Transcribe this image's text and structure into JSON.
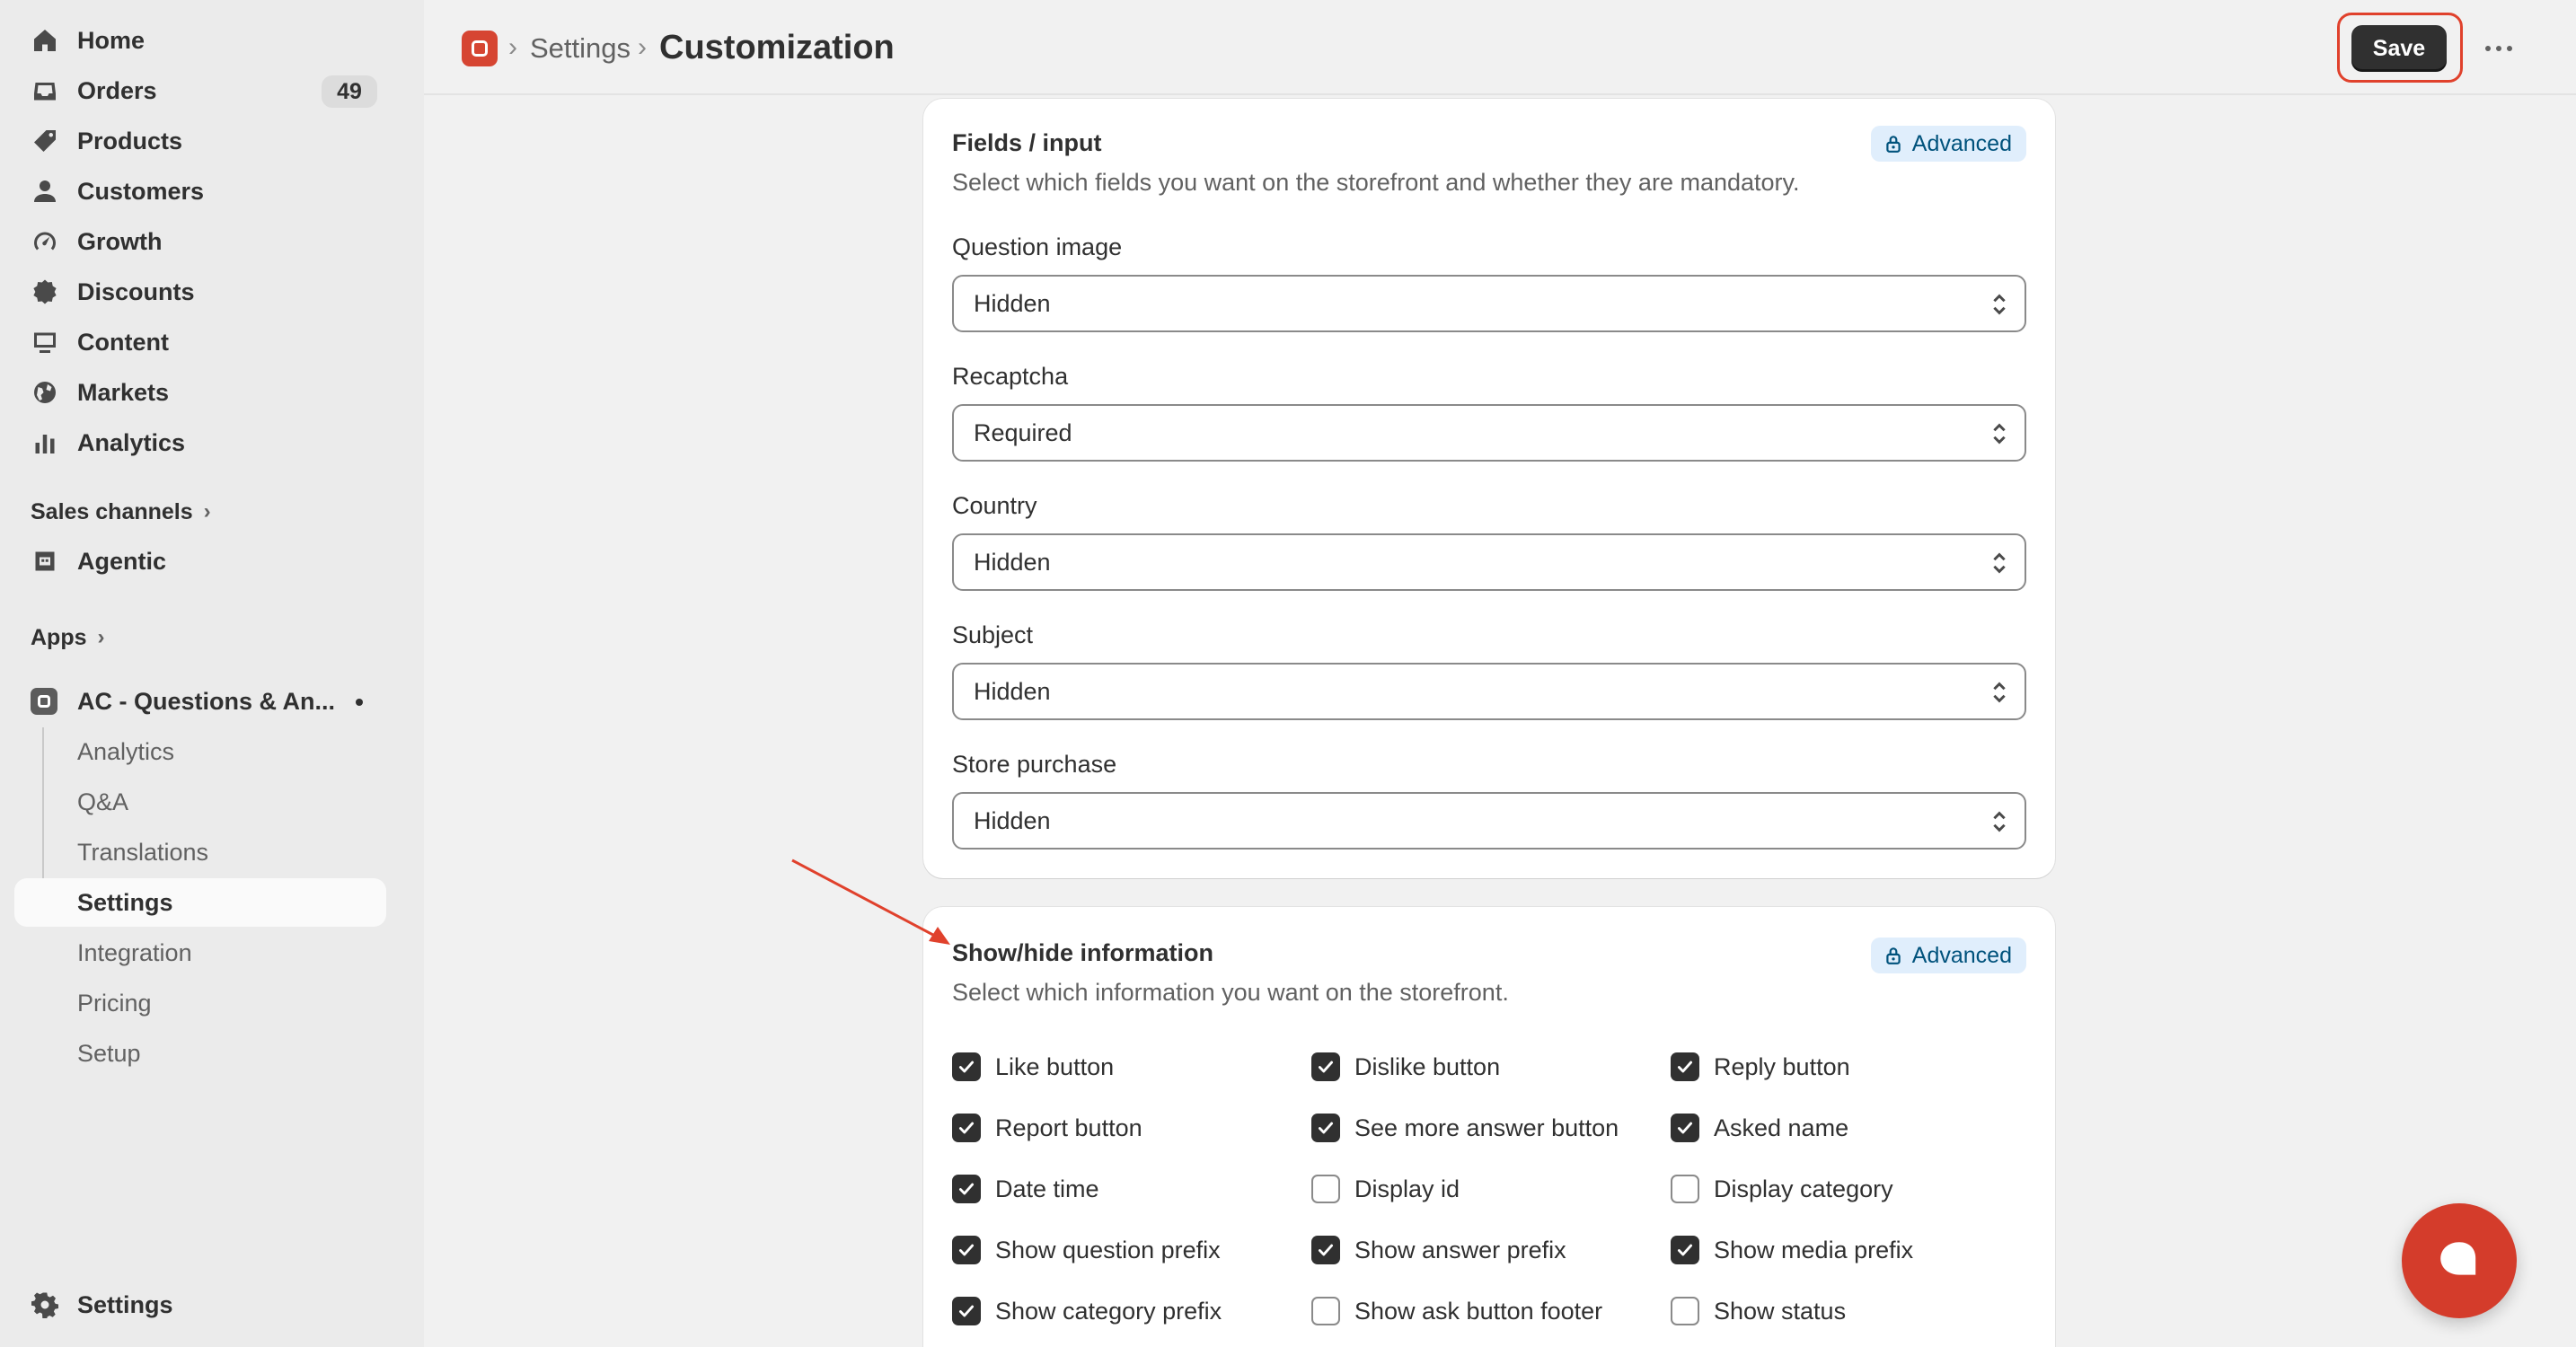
{
  "sidebar": {
    "items": [
      {
        "label": "Home",
        "icon": "home-icon"
      },
      {
        "label": "Orders",
        "icon": "orders-icon",
        "badge": "49"
      },
      {
        "label": "Products",
        "icon": "tag-icon"
      },
      {
        "label": "Customers",
        "icon": "person-icon"
      },
      {
        "label": "Growth",
        "icon": "gauge-icon"
      },
      {
        "label": "Discounts",
        "icon": "discount-icon"
      },
      {
        "label": "Content",
        "icon": "monitor-icon"
      },
      {
        "label": "Markets",
        "icon": "globe-icon"
      },
      {
        "label": "Analytics",
        "icon": "bar-chart-icon"
      }
    ],
    "sales_channels": "Sales channels",
    "agentic": "Agentic",
    "apps": "Apps",
    "app_name": "AC - Questions & An...",
    "app_sub": [
      "Analytics",
      "Q&A",
      "Translations",
      "Settings",
      "Integration",
      "Pricing",
      "Setup"
    ],
    "footer_settings": "Settings"
  },
  "header": {
    "breadcrumb_parent": "Settings",
    "title": "Customization",
    "save_label": "Save"
  },
  "fields_card": {
    "title": "Fields / input",
    "badge": "Advanced",
    "description": "Select which fields you want on the storefront and whether they are mandatory.",
    "fields": [
      {
        "label": "Question image",
        "value": "Hidden"
      },
      {
        "label": "Recaptcha",
        "value": "Required"
      },
      {
        "label": "Country",
        "value": "Hidden"
      },
      {
        "label": "Subject",
        "value": "Hidden"
      },
      {
        "label": "Store purchase",
        "value": "Hidden"
      }
    ]
  },
  "info_card": {
    "title": "Show/hide information",
    "badge": "Advanced",
    "description": "Select which information you want on the storefront.",
    "checkboxes": [
      {
        "label": "Like button",
        "checked": true
      },
      {
        "label": "Dislike button",
        "checked": true
      },
      {
        "label": "Reply button",
        "checked": true
      },
      {
        "label": "Report button",
        "checked": true
      },
      {
        "label": "See more answer button",
        "checked": true
      },
      {
        "label": "Asked name",
        "checked": true
      },
      {
        "label": "Date time",
        "checked": true
      },
      {
        "label": "Display id",
        "checked": false
      },
      {
        "label": "Display category",
        "checked": false
      },
      {
        "label": "Show question prefix",
        "checked": true
      },
      {
        "label": "Show answer prefix",
        "checked": true
      },
      {
        "label": "Show media prefix",
        "checked": true
      },
      {
        "label": "Show category prefix",
        "checked": true
      },
      {
        "label": "Show ask button footer",
        "checked": false
      },
      {
        "label": "Show status",
        "checked": false
      }
    ]
  },
  "colors": {
    "accent_red": "#d64532",
    "annotation_red": "#e0412c",
    "primary_dark": "#303030",
    "advanced_badge_bg": "#e0eefc"
  }
}
